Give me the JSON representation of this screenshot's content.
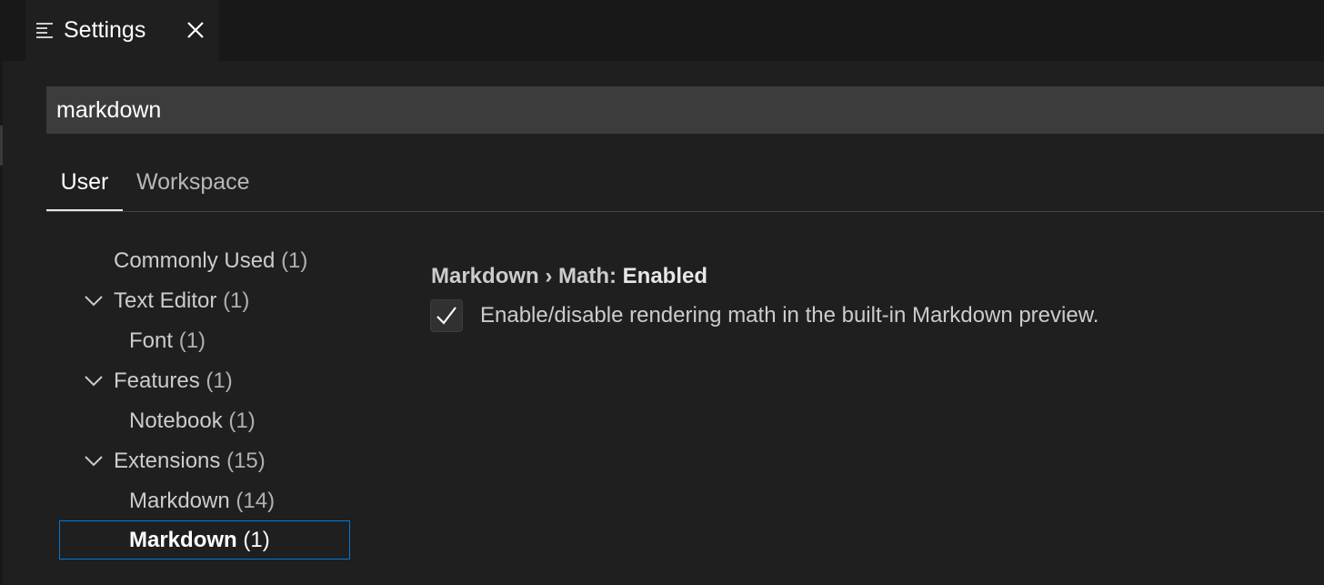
{
  "editor_tab": {
    "title": "Settings",
    "icon": "settings-list-icon",
    "close_icon": "close-icon"
  },
  "search": {
    "value": "markdown"
  },
  "scope_tabs": [
    {
      "label": "User",
      "active": true
    },
    {
      "label": "Workspace",
      "active": false
    }
  ],
  "toc": {
    "items": [
      {
        "label": "Commonly Used",
        "count": "(1)",
        "expanded": null
      },
      {
        "label": "Text Editor",
        "count": "(1)",
        "expanded": true
      },
      {
        "label": "Font",
        "count": "(1)",
        "expanded": null
      },
      {
        "label": "Features",
        "count": "(1)",
        "expanded": true
      },
      {
        "label": "Notebook",
        "count": "(1)",
        "expanded": null
      },
      {
        "label": "Extensions",
        "count": "(15)",
        "expanded": true
      },
      {
        "label": "Markdown",
        "count": "(14)",
        "expanded": null
      },
      {
        "label": "Markdown",
        "count": "(1)",
        "expanded": null,
        "selected": true
      }
    ]
  },
  "setting": {
    "category": "Markdown › Math: ",
    "key": "Enabled",
    "checked": true,
    "description": "Enable/disable rendering math in the built-in Markdown preview."
  },
  "colors": {
    "background": "#1f1f1f",
    "tabbar": "#181818",
    "search_bg": "#3c3c3c",
    "focus_border": "#0078d4"
  }
}
